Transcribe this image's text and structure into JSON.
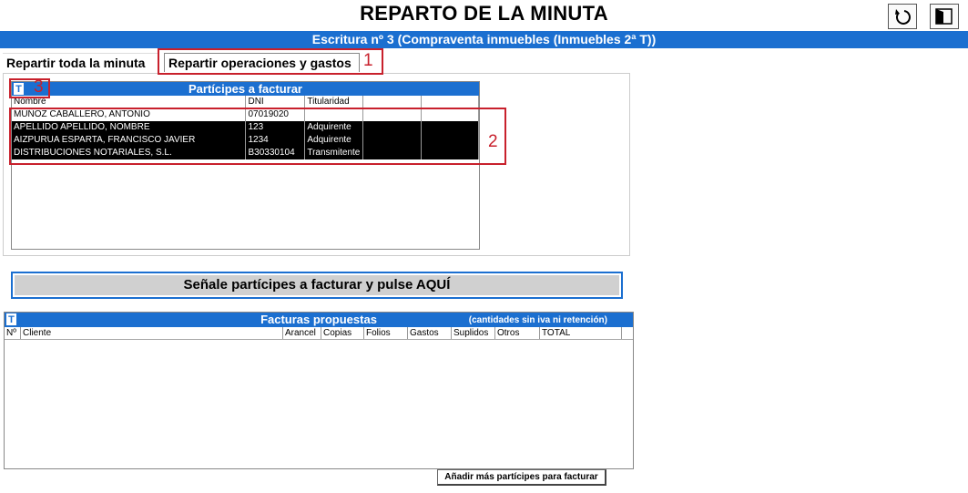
{
  "window": {
    "title": "REPARTO DE LA MINUTA"
  },
  "toolbar": {
    "refresh_icon": "refresh-icon",
    "exit_icon": "exit-door-icon"
  },
  "deed": {
    "label": "Escritura nº 3 (Compraventa inmuebles (Inmuebles 2ª T))"
  },
  "tabs": [
    {
      "label": "Repartir toda la minuta"
    },
    {
      "label": "Repartir operaciones y gastos"
    }
  ],
  "annotations": {
    "n1": "1",
    "n2": "2",
    "n3": "3"
  },
  "participants": {
    "header": "Partícipes a facturar",
    "columns": [
      "Nombre",
      "DNI",
      "Titularidad",
      "",
      ""
    ],
    "rows": [
      {
        "nombre": "MUÑOZ CABALLERO, ANTONIO",
        "dni": "07019020",
        "titularidad": "",
        "selected": false
      },
      {
        "nombre": "APELLIDO APELLIDO, NOMBRE",
        "dni": "123",
        "titularidad": "Adquirente",
        "selected": true
      },
      {
        "nombre": "AIZPURUA ESPARTA, FRANCISCO JAVIER",
        "dni": "1234",
        "titularidad": "Adquirente",
        "selected": true
      },
      {
        "nombre": "DISTRIBUCIONES NOTARIALES, S.L.",
        "dni": "B30330104",
        "titularidad": "Transmitente",
        "selected": true
      }
    ]
  },
  "action": {
    "label": "Señale partícipes a facturar y pulse AQUÍ"
  },
  "invoices": {
    "header": "Facturas propuestas",
    "note": "(cantidades sin iva ni retención)",
    "columns": [
      "Nº",
      "Cliente",
      "Arancel",
      "Copias",
      "Folios",
      "Gastos",
      "Suplidos",
      "Otros",
      "TOTAL"
    ]
  },
  "add_button": {
    "label": "Añadir más partícipes para facturar"
  },
  "colors": {
    "accent": "#1b6fd0",
    "annotation": "#c8202c"
  }
}
